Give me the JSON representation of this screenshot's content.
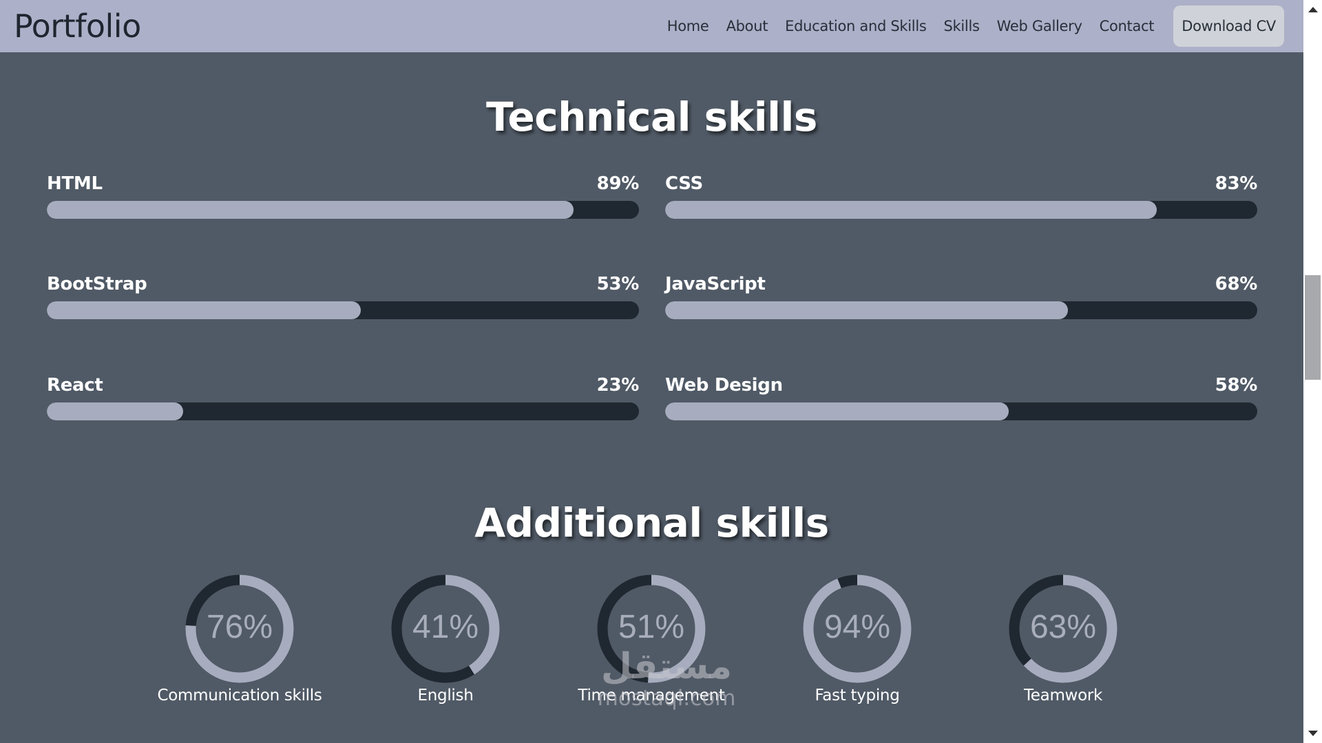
{
  "nav": {
    "brand": "Portfolio",
    "links": [
      "Home",
      "About",
      "Education and Skills",
      "Skills",
      "Web Gallery",
      "Contact"
    ],
    "cta": "Download CV"
  },
  "technical": {
    "title": "Technical skills",
    "skills": [
      {
        "name": "HTML",
        "pct_label": "89%",
        "value": 89
      },
      {
        "name": "CSS",
        "pct_label": "83%",
        "value": 83
      },
      {
        "name": "BootStrap",
        "pct_label": "53%",
        "value": 53
      },
      {
        "name": "JavaScript",
        "pct_label": "68%",
        "value": 68
      },
      {
        "name": "React",
        "pct_label": "23%",
        "value": 23
      },
      {
        "name": "Web Design",
        "pct_label": "58%",
        "value": 58
      }
    ]
  },
  "additional": {
    "title": "Additional skills",
    "skills": [
      {
        "name": "Communication skills",
        "pct_label": "76%",
        "value": 76
      },
      {
        "name": "English",
        "pct_label": "41%",
        "value": 41
      },
      {
        "name": "Time management",
        "pct_label": "51%",
        "value": 51
      },
      {
        "name": "Fast typing",
        "pct_label": "94%",
        "value": 94
      },
      {
        "name": "Teamwork",
        "pct_label": "63%",
        "value": 63
      }
    ]
  },
  "watermark": {
    "arabic": "مستقل",
    "latin": "mostaql.com"
  },
  "colors": {
    "navbar": "#acb0c8",
    "background": "#505a66",
    "track": "#1f2730",
    "fill": "#a7adbe"
  }
}
